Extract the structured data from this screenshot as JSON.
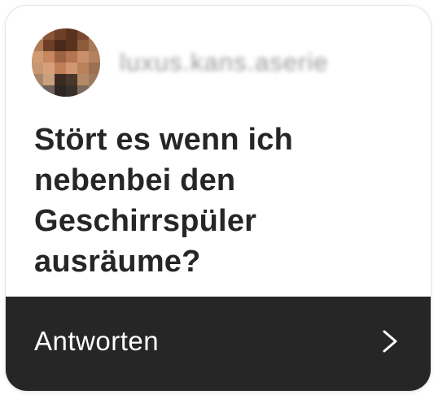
{
  "header": {
    "username": "luxus.kans.aserie"
  },
  "question": {
    "text": "Stört es wenn ich\nnebenbei den\nGeschirrspüler\nausräume?"
  },
  "reply": {
    "label": "Antworten",
    "icon": "chevron-right-icon"
  },
  "colors": {
    "reply_bar": "#262626",
    "text": "#262626",
    "background": "#ffffff"
  }
}
